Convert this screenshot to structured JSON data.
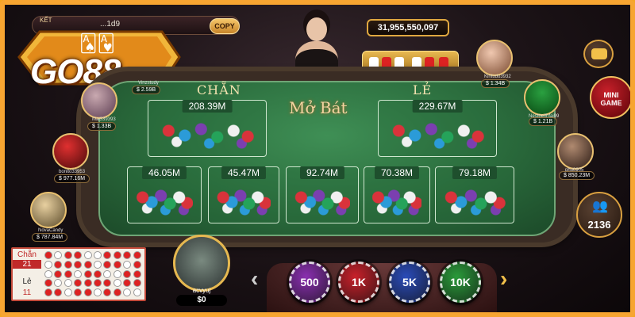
{
  "header": {
    "result_label": "KẾT",
    "game_id": "...1d9",
    "copy_label": "COPY",
    "logo_text": "GO88"
  },
  "jackpot": {
    "amount": "31,955,550,097"
  },
  "table": {
    "chan_label": "CHẴN",
    "le_label": "LẺ",
    "center_text": "Mở Bát",
    "bets": {
      "chan": "208.39M",
      "le": "229.67M",
      "slot1": "46.05M",
      "slot2": "45.47M",
      "slot3": "92.74M",
      "slot4": "70.38M",
      "slot5": "79.18M"
    }
  },
  "players": {
    "top_left": {
      "name": "Vinzstudy",
      "money": "$ 2.59B"
    },
    "left_1": {
      "name": "Mai339393",
      "money": "$ 1.33B"
    },
    "left_2": {
      "name": "bonito33953",
      "money": "$ 977.16M"
    },
    "left_3": {
      "name": "NovaCandy",
      "money": "$ 787.84M"
    },
    "right_1": {
      "name": "Kintudo3932",
      "money": "$ 1.34B"
    },
    "right_2": {
      "name": "Nestbeifhfai99",
      "money": "$ 1.21B"
    },
    "right_3": {
      "name": "phu0905",
      "money": "$ 850.23M"
    }
  },
  "self_player": {
    "name": "acvyuj",
    "money": "$0"
  },
  "buttons": {
    "mini_game_label_1": "MINI",
    "mini_game_label_2": "GAME",
    "online_count": "2136"
  },
  "history": {
    "chan_label": "Chẵn",
    "chan_count": "21",
    "le_label": "Lẻ",
    "le_count": "11"
  },
  "chips": [
    {
      "label": "500",
      "color": "#8a2fb0"
    },
    {
      "label": "1K",
      "color": "#c8202a"
    },
    {
      "label": "5K",
      "color": "#2a4bb8"
    },
    {
      "label": "10K",
      "color": "#2a9a3a"
    }
  ],
  "colors": {
    "frame": "#f7a531",
    "felt": "#2a6b3c",
    "gold": "#f2c04a"
  }
}
